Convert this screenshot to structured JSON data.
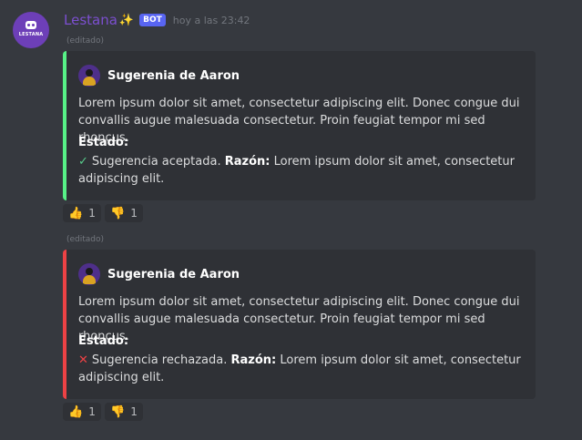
{
  "author": {
    "username": "Lestana",
    "sparkle": "✨",
    "bot_tag": "BOT",
    "timestamp": "hoy a las 23:42",
    "avatar_text": "LESTANA"
  },
  "messages": [
    {
      "edited_label": "(editado)",
      "embed": {
        "color": "#57f287",
        "author_name": "Sugerenia de Aaron",
        "description": "Lorem ipsum dolor sit amet, consectetur adipiscing elit. Donec congue dui convallis augue malesuada consectetur. Proin feugiat tempor mi sed rhoncus.",
        "field_name": "Estado:",
        "status_icon": "check-icon",
        "status_text": "Sugerencia aceptada.",
        "reason_label": "Razón:",
        "reason_text": "Lorem ipsum dolor sit amet, consectetur adipiscing elit."
      },
      "reactions": [
        {
          "emoji": "👍",
          "icon": "thumbs-up-icon",
          "count": "1"
        },
        {
          "emoji": "👎",
          "icon": "thumbs-down-icon",
          "count": "1"
        }
      ]
    },
    {
      "edited_label": "(editado)",
      "embed": {
        "color": "#ed4245",
        "author_name": "Sugerenia de Aaron",
        "description": "Lorem ipsum dolor sit amet, consectetur adipiscing elit. Donec congue dui convallis augue malesuada consectetur. Proin feugiat tempor mi sed rhoncus.",
        "field_name": "Estado:",
        "status_icon": "cross-icon",
        "status_text": "Sugerencia rechazada.",
        "reason_label": "Razón:",
        "reason_text": "Lorem ipsum dolor sit amet, consectetur adipiscing elit."
      },
      "reactions": [
        {
          "emoji": "👍",
          "icon": "thumbs-up-icon",
          "count": "1"
        },
        {
          "emoji": "👎",
          "icon": "thumbs-down-icon",
          "count": "1"
        }
      ]
    }
  ]
}
